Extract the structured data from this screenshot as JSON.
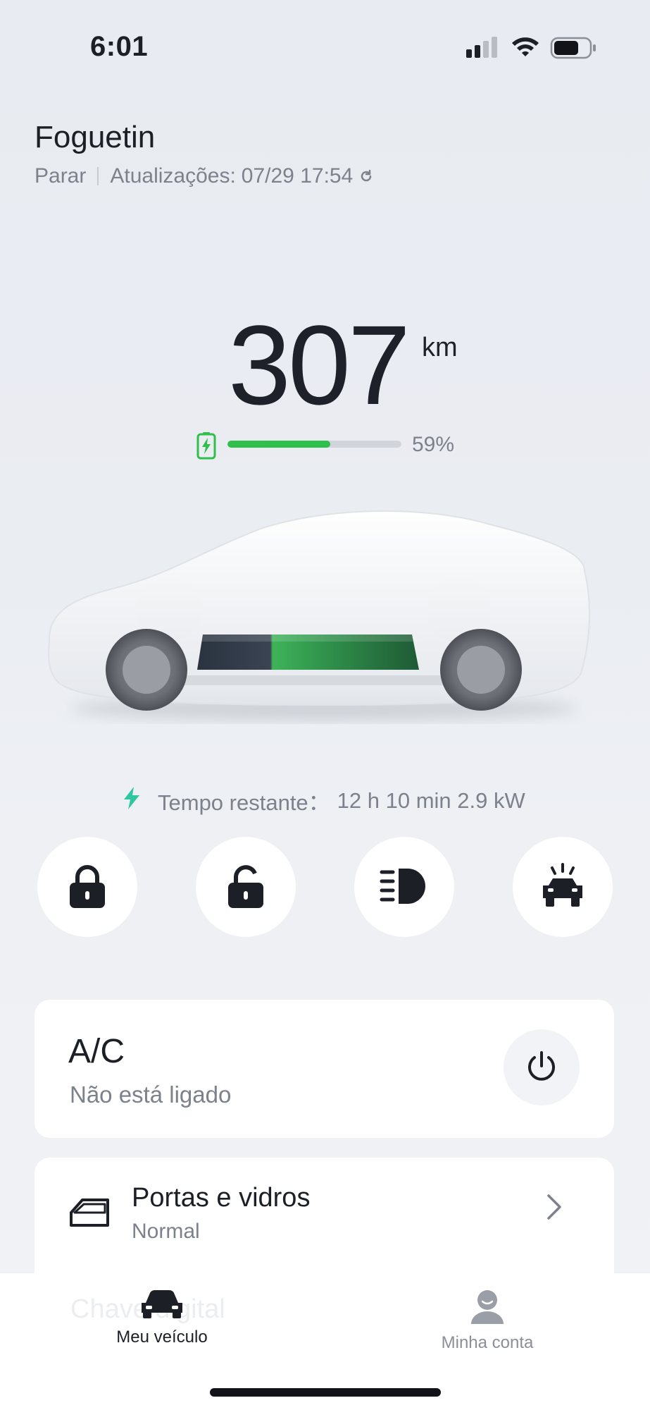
{
  "status_bar": {
    "time": "6:01"
  },
  "header": {
    "vehicle_name": "Foguetin",
    "state": "Parar",
    "updated_label": "Atualizações:",
    "updated_time": "07/29 17:54"
  },
  "range": {
    "value": "307",
    "unit": "km",
    "battery_percent_label": "59%",
    "battery_level": 0.59
  },
  "charging": {
    "label": "Tempo restante：",
    "value": "12 h 10 min 2.9 kW"
  },
  "quick_actions": [
    {
      "icon": "lock-icon",
      "action": "lock"
    },
    {
      "icon": "unlock-icon",
      "action": "unlock"
    },
    {
      "icon": "headlight-icon",
      "action": "headlights"
    },
    {
      "icon": "car-alarm-icon",
      "action": "find-car"
    }
  ],
  "ac_card": {
    "title": "A/C",
    "status": "Não está ligado"
  },
  "doors_card": {
    "title": "Portas e vidros",
    "status": "Normal"
  },
  "partial_card": {
    "title": "Chave digital"
  },
  "tabs": [
    {
      "label": "Meu veículo",
      "active": true
    },
    {
      "label": "Minha conta",
      "active": false
    }
  ],
  "colors": {
    "accent_green": "#2fbf4a",
    "charge_bolt": "#2fc7a0",
    "text_primary": "#1c1f26",
    "text_secondary": "#7c818c"
  }
}
